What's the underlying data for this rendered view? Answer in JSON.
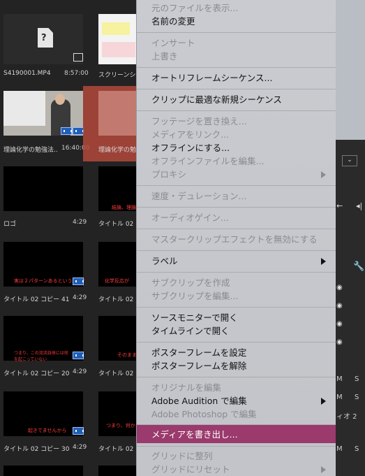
{
  "project_panel": {
    "tiles": [
      {
        "label": "S4190001.MP4",
        "duration": "8:57:00"
      },
      {
        "label": "スクリーンシ",
        "duration": ""
      },
      {
        "label": "理論化学の勉強法..",
        "duration": "16:40:00"
      },
      {
        "label": "理論化学の勉",
        "duration": ""
      },
      {
        "label": "ロゴ",
        "duration": "4:29"
      },
      {
        "label": "タイトル 02 コ",
        "duration": "4:29"
      },
      {
        "label": "タイトル 02 コピー 41",
        "duration": "4:29"
      },
      {
        "label": "タイトル 02 コ",
        "duration": ""
      },
      {
        "label": "タイトル 02 コピー 20",
        "duration": "4:29"
      },
      {
        "label": "タイトル 02 コ",
        "duration": ""
      },
      {
        "label": "タイトル 02 コピー 30",
        "duration": "4:29"
      },
      {
        "label": "タイトル 02 コ",
        "duration": ""
      }
    ],
    "red_overlays": [
      "結論、理論化",
      "実は２パターンあるということ?",
      "化学反応が",
      "つまり、この流流自体には何を起こっていない",
      "そのまま",
      "起きてませんから",
      "つまり、何か"
    ]
  },
  "context_menu": {
    "items": [
      {
        "label": "元のファイルを表示...",
        "enabled": false
      },
      {
        "label": "名前の変更",
        "enabled": true
      },
      {
        "label": "インサート",
        "enabled": false
      },
      {
        "label": "上書き",
        "enabled": false
      },
      {
        "label": "オートリフレームシーケンス...",
        "enabled": true
      },
      {
        "label": "クリップに最適な新規シーケンス",
        "enabled": true
      },
      {
        "label": "フッテージを置き換え...",
        "enabled": false
      },
      {
        "label": "メディアをリンク...",
        "enabled": false
      },
      {
        "label": "オフラインにする...",
        "enabled": true
      },
      {
        "label": "オフラインファイルを編集...",
        "enabled": false
      },
      {
        "label": "プロキシ",
        "enabled": false
      },
      {
        "label": "速度・デュレーション...",
        "enabled": false
      },
      {
        "label": "オーディオゲイン...",
        "enabled": false
      },
      {
        "label": "マスタークリップエフェクトを無効にする",
        "enabled": false
      },
      {
        "label": "ラベル",
        "enabled": true
      },
      {
        "label": "サブクリップを作成",
        "enabled": false
      },
      {
        "label": "サブクリップを編集...",
        "enabled": false
      },
      {
        "label": "ソースモニターで開く",
        "enabled": true
      },
      {
        "label": "タイムラインで開く",
        "enabled": true
      },
      {
        "label": "ポスターフレームを設定",
        "enabled": true
      },
      {
        "label": "ポスターフレームを解除",
        "enabled": true
      },
      {
        "label": "オリジナルを編集",
        "enabled": false
      },
      {
        "label": "Adobe Audition で編集",
        "enabled": true
      },
      {
        "label": "Adobe Photoshop で編集",
        "enabled": false
      },
      {
        "label": "メディアを書き出し...",
        "enabled": true,
        "highlighted": true
      },
      {
        "label": "グリッドに整列",
        "enabled": false
      },
      {
        "label": "グリッドにリセット",
        "enabled": false
      }
    ]
  },
  "right_panel": {
    "labels": [
      "M",
      "S",
      "M",
      "S",
      "ィオ 2",
      "M",
      "S"
    ]
  },
  "colors": {
    "highlight": "#9b3a6c",
    "menu_bg": "#c6c8cd",
    "selection": "#b3483b"
  }
}
